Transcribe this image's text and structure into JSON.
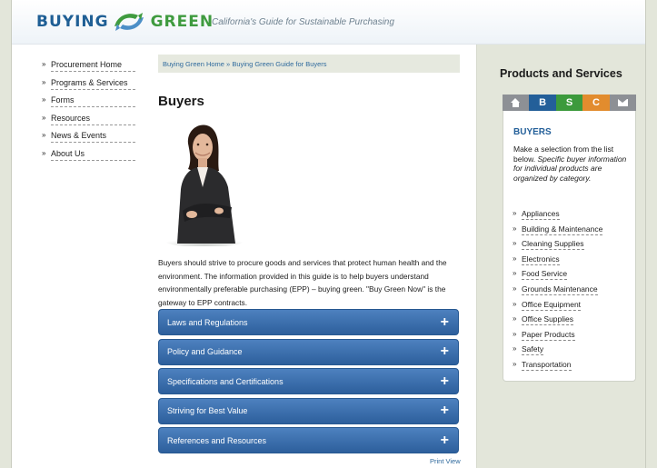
{
  "header": {
    "logo_word_1": "BUYING",
    "logo_word_2": "GREEN",
    "tagline": "California's Guide for Sustainable Purchasing"
  },
  "left_nav": {
    "items": [
      {
        "label": "Procurement Home"
      },
      {
        "label": "Programs & Services"
      },
      {
        "label": "Forms"
      },
      {
        "label": "Resources"
      },
      {
        "label": "News & Events"
      },
      {
        "label": "About Us"
      }
    ]
  },
  "breadcrumb": {
    "home": "Buying Green Home",
    "separator": "»",
    "current": "Buying Green Guide for Buyers"
  },
  "main": {
    "title": "Buyers",
    "intro": "Buyers should strive to procure goods and services that protect human health and the environment. The information provided in this guide is to help buyers understand environmentally preferable purchasing (EPP) – buying green. \"Buy Green Now\" is the gateway to EPP contracts.",
    "accordion": [
      {
        "label": "Laws and Regulations"
      },
      {
        "label": "Policy and Guidance"
      },
      {
        "label": "Specifications and Certifications"
      },
      {
        "label": "Striving for Best Value"
      },
      {
        "label": "References and Resources"
      }
    ],
    "plus_glyph": "+",
    "print_view": "Print View"
  },
  "sidebar": {
    "title": "Products and Services",
    "tabs": {
      "b": "B",
      "s": "S",
      "c": "C"
    },
    "panel_title": "BUYERS",
    "panel_text_plain": "Make a selection from the list below.",
    "panel_text_italic": "Specific buyer information for individual products are organized by category.",
    "categories": [
      {
        "label": "Appliances"
      },
      {
        "label": "Building & Maintenance"
      },
      {
        "label": "Cleaning Supplies"
      },
      {
        "label": "Electronics"
      },
      {
        "label": "Food Service"
      },
      {
        "label": "Grounds Maintenance"
      },
      {
        "label": "Office Equipment"
      },
      {
        "label": "Office Supplies"
      },
      {
        "label": "Paper Products"
      },
      {
        "label": "Safety"
      },
      {
        "label": "Transportation"
      }
    ]
  },
  "colors": {
    "brand_blue": "#235f99",
    "brand_green": "#3c9a3c",
    "accent_orange": "#e28c2e",
    "accordion_blue": "#3a6eae",
    "link_blue": "#2f6a9d"
  },
  "icons": {
    "home_tab": "home-icon",
    "mail_tab": "mail-icon",
    "logo": "recycle-leaf-logo",
    "list_bullet": "chevron-right-icon"
  }
}
